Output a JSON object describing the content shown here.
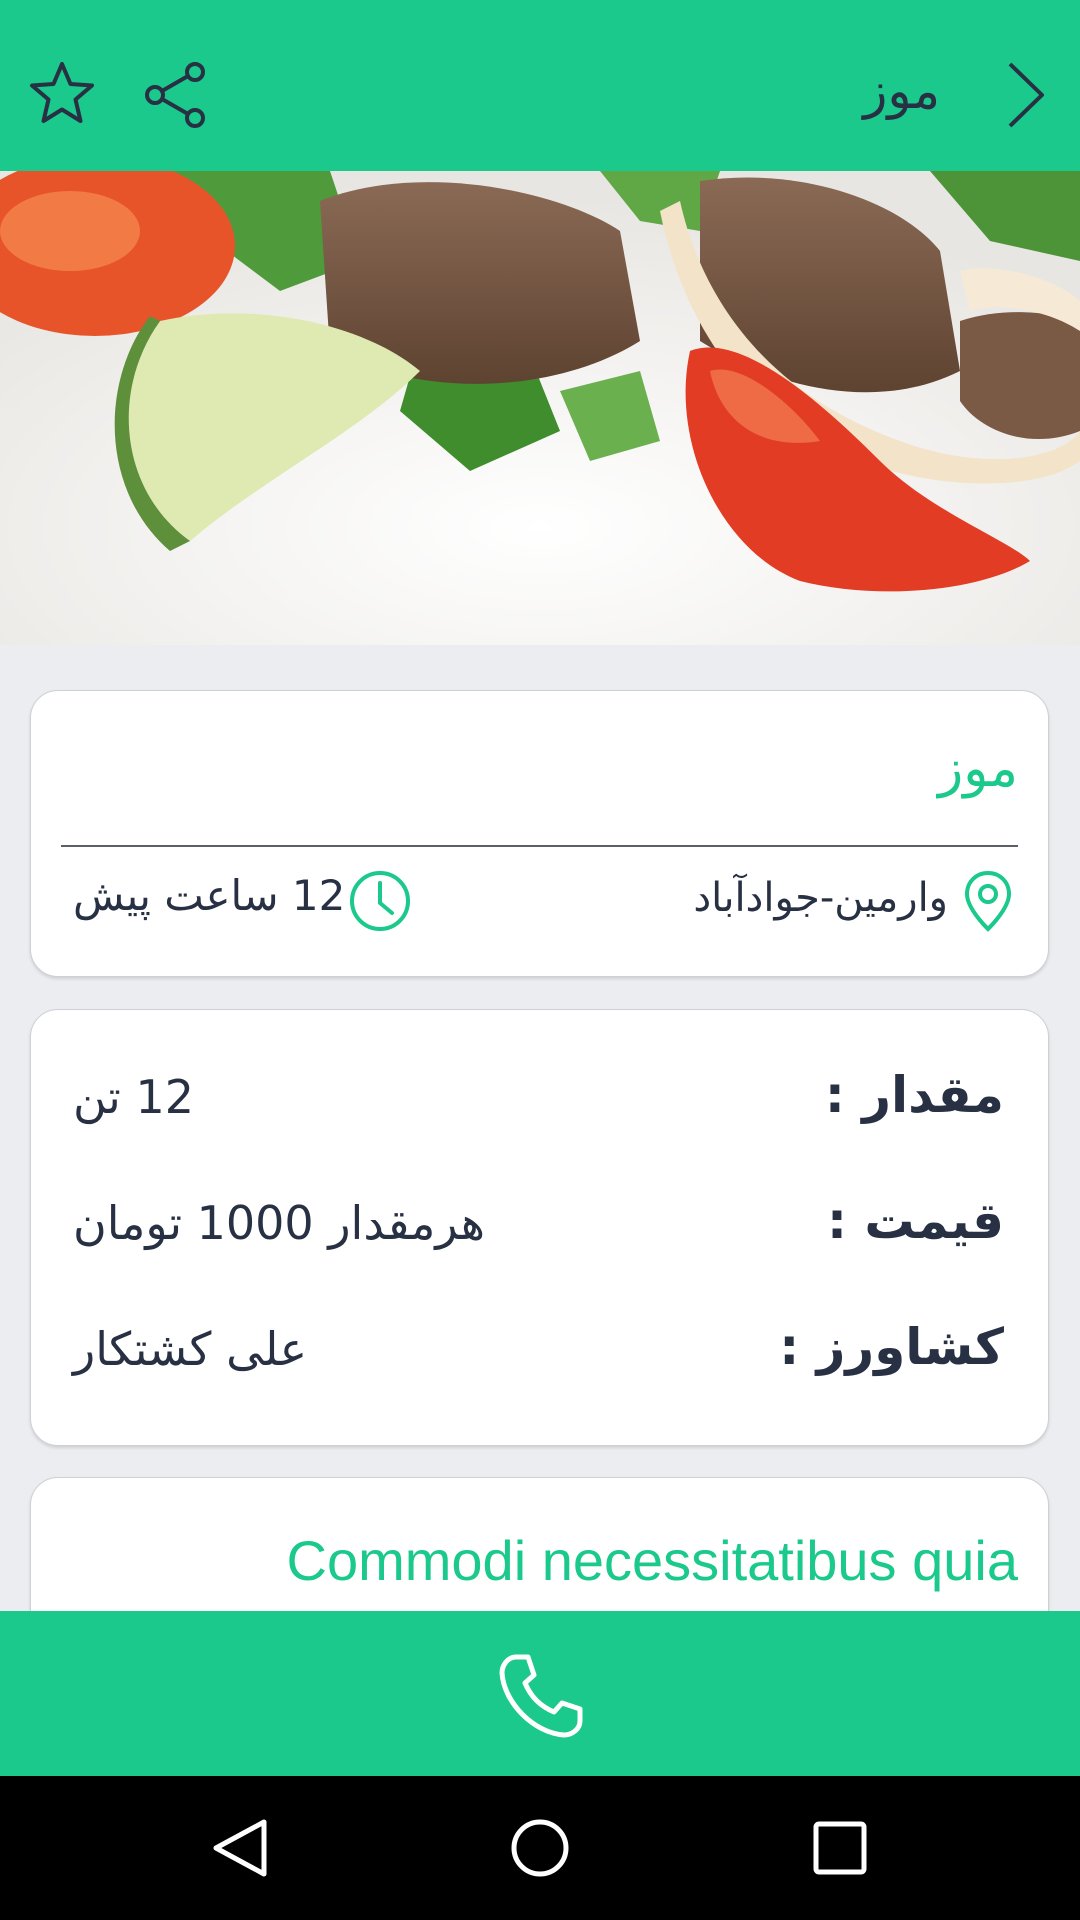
{
  "app_bar": {
    "title": "موز",
    "back_icon": "chevron-right-icon",
    "share_icon": "share-icon",
    "favorite_icon": "star-outline-icon",
    "background_color": "#1ac98b"
  },
  "gallery": {
    "page_count": 2,
    "active_index": 0,
    "active_dot_color": "#1a73e8",
    "inactive_dot_color": "#a9a9a9"
  },
  "summary_card": {
    "title": "موز",
    "location": "وارمین-جوادآباد",
    "location_icon": "map-pin-icon",
    "time": "12 ساعت پیش",
    "time_icon": "clock-icon"
  },
  "details_card": {
    "rows": [
      {
        "label": "مقدار :",
        "value": "12 تن"
      },
      {
        "label": "قیمت :",
        "value": "هرمقدار 1000 تومان"
      },
      {
        "label": "کشاورز :",
        "value": "علی کشتکار"
      }
    ]
  },
  "description_card": {
    "title": "Commodi necessitatibus quia"
  },
  "call_bar": {
    "icon": "phone-icon",
    "background_color": "#1ac98b"
  },
  "navigation_bar": {
    "back_icon": "triangle-back-icon",
    "home_icon": "circle-home-icon",
    "recents_icon": "square-recents-icon"
  }
}
